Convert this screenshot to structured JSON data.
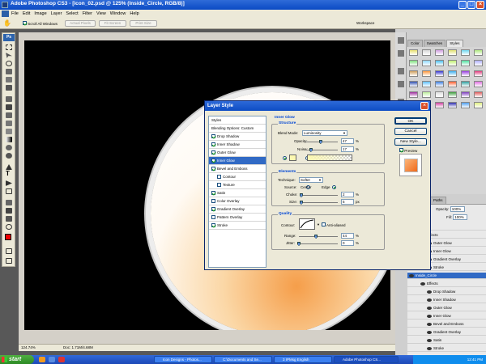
{
  "window": {
    "title": "Adobe Photoshop CS3 - [icon_02.psd @ 125% (Inside_Circle, RGB/8)]"
  },
  "menu": [
    "File",
    "Edit",
    "Image",
    "Layer",
    "Select",
    "Filter",
    "View",
    "Window",
    "Help"
  ],
  "options": {
    "scroll_all": "Scroll All Windows",
    "actual_pixels": "Actual Pixels",
    "fit_screen": "Fit Screen",
    "print_size": "Print Size",
    "workspace": "Workspace"
  },
  "toolbox": {
    "logo": "Ps"
  },
  "status": {
    "zoom": "124.74%",
    "doc": "Doc: 1.71M/4.68M"
  },
  "panels": {
    "tabs": [
      "Color",
      "Swatches",
      "Styles"
    ],
    "layer_tabs": [
      "Channels",
      "Paths"
    ],
    "opacity_label": "Opacity:",
    "opacity": "100%",
    "fill_label": "Fill:",
    "fill": "100%"
  },
  "layers": [
    "Layer 3",
    "Effects",
    "Outer Glow",
    "Inner Glow",
    "Gradient Overlay",
    "Stroke",
    "Inside_Circle",
    "Effects",
    "Drop Shadow",
    "Inner Shadow",
    "Outer Glow",
    "Inner Glow",
    "Bevel and Emboss",
    "Gradient Overlay",
    "Satin",
    "Stroke"
  ],
  "dialog": {
    "title": "Layer Style",
    "styles_header": "Styles",
    "blending": "Blending Options: Custom",
    "items": [
      {
        "label": "Drop Shadow",
        "checked": true
      },
      {
        "label": "Inner Shadow",
        "checked": true
      },
      {
        "label": "Outer Glow",
        "checked": true
      },
      {
        "label": "Inner Glow",
        "checked": true,
        "selected": true
      },
      {
        "label": "Bevel and Emboss",
        "checked": true
      },
      {
        "label": "Contour",
        "checked": false
      },
      {
        "label": "Texture",
        "checked": false
      },
      {
        "label": "Satin",
        "checked": true
      },
      {
        "label": "Color Overlay",
        "checked": false
      },
      {
        "label": "Gradient Overlay",
        "checked": true
      },
      {
        "label": "Pattern Overlay",
        "checked": false
      },
      {
        "label": "Stroke",
        "checked": true
      }
    ],
    "inner_glow": "Inner Glow",
    "structure": "Structure",
    "blend_mode_label": "Blend Mode:",
    "blend_mode": "Luminosity",
    "opacity_label": "Opacity:",
    "opacity": "47",
    "opacity_level": 0.47,
    "noise_label": "Noise:",
    "noise": "17",
    "noise_level": 0.17,
    "elements": "Elements",
    "technique_label": "Technique:",
    "technique": "Softer",
    "source_label": "Source:",
    "center": "Center",
    "edge": "Edge",
    "choke_label": "Choke:",
    "choke": "2",
    "choke_level": 0.02,
    "size_label": "Size:",
    "size": "5",
    "size_level": 0.02,
    "quality": "Quality",
    "contour_label": "Contour:",
    "anti_aliased": "Anti-aliased",
    "range_label": "Range:",
    "range": "44",
    "range_level": 0.44,
    "jitter_label": "Jitter:",
    "jitter": "0",
    "jitter_level": 0,
    "pct": "%",
    "px": "px",
    "ok": "OK",
    "cancel": "Cancel",
    "new_style": "New Style...",
    "preview": "Preview"
  },
  "taskbar": {
    "start": "start",
    "buttons": [
      "Icon Designs - Photos...",
      "C:\\Documents and Se...",
      "3 IPMsg English",
      "Adobe Photoshop CS..."
    ],
    "time": "12:41 PM"
  }
}
